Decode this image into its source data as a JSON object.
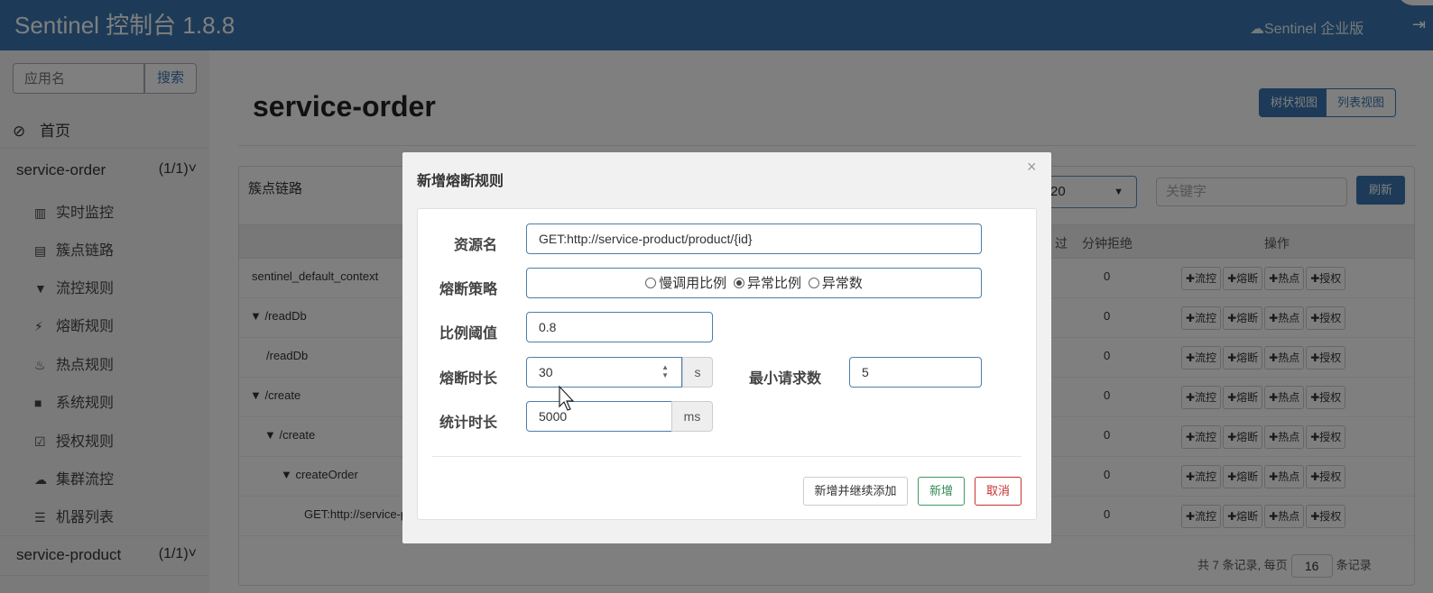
{
  "header": {
    "brand": "Sentinel 控制台 1.8.8",
    "enterprise": "Sentinel 企业版",
    "enterprise_icon": "cloud-icon",
    "logout_icon": "logout-icon"
  },
  "sidebar": {
    "search_placeholder": "应用名",
    "search_button": "搜索",
    "home_label": "首页",
    "apps": [
      {
        "name": "service-order",
        "count": "(1/1)"
      },
      {
        "name": "service-product",
        "count": "(1/1)"
      }
    ],
    "menu": [
      {
        "label": "实时监控",
        "icon": "bar-chart-icon"
      },
      {
        "label": "簇点链路",
        "icon": "list-icon"
      },
      {
        "label": "流控规则",
        "icon": "filter-icon"
      },
      {
        "label": "熔断规则",
        "icon": "flash-icon"
      },
      {
        "label": "热点规则",
        "icon": "fire-icon"
      },
      {
        "label": "系统规则",
        "icon": "lock-icon"
      },
      {
        "label": "授权规则",
        "icon": "check-icon"
      },
      {
        "label": "集群流控",
        "icon": "cloud-icon"
      },
      {
        "label": "机器列表",
        "icon": "th-list-icon"
      }
    ]
  },
  "main": {
    "title": "service-order",
    "view_tree": "树状视图",
    "view_list": "列表视图",
    "panel_title": "簇点链路",
    "select_value": "20",
    "keyword_placeholder": "关键字",
    "refresh": "刷新",
    "headers": {
      "pass": "过",
      "block": "分钟拒绝",
      "ops": "操作"
    },
    "rows": [
      {
        "name": "sentinel_default_context",
        "value": "0"
      },
      {
        "name": "▼ /readDb",
        "value": "0"
      },
      {
        "name": "/readDb",
        "value": "0"
      },
      {
        "name": "▼ /create",
        "value": "0"
      },
      {
        "name": "▼ /create",
        "value": "0"
      },
      {
        "name": "▼ createOrder",
        "value": "0"
      },
      {
        "name": "GET:http://service-p",
        "value": "0"
      }
    ],
    "ops": [
      "流控",
      "熔断",
      "热点",
      "授权"
    ],
    "pager": {
      "prefix": "共 7 条记录, 每页",
      "size": "16",
      "suffix": "条记录"
    }
  },
  "modal": {
    "title": "新增熔断规则",
    "close": "×",
    "resource_label": "资源名",
    "resource_value": "GET:http://service-product/product/{id}",
    "strategy_label": "熔断策略",
    "strategy_options": [
      "慢调用比例",
      "异常比例",
      "异常数"
    ],
    "strategy_selected": "异常比例",
    "threshold_label": "比例阈值",
    "threshold_value": "0.8",
    "duration_label": "熔断时长",
    "duration_value": "30",
    "duration_unit": "s",
    "min_req_label": "最小请求数",
    "min_req_value": "5",
    "stat_label": "统计时长",
    "stat_value": "5000",
    "stat_unit": "ms",
    "btn_continue": "新增并继续添加",
    "btn_add": "新增",
    "btn_cancel": "取消"
  }
}
